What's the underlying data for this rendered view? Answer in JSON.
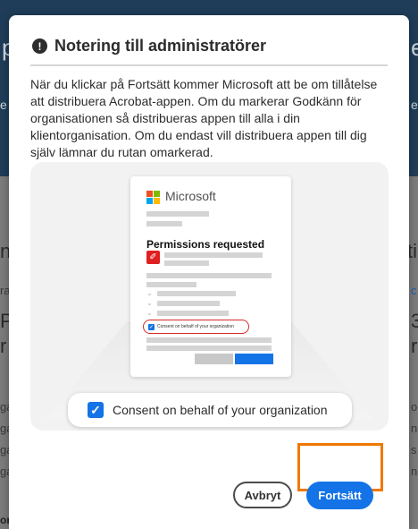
{
  "background": {
    "fragments_top": [
      "p",
      "e"
    ],
    "fragments_bottom": [
      "ne",
      "ra",
      "Po",
      "r",
      "ga",
      "ga",
      "ga",
      "ga"
    ],
    "fragments_right": [
      "e",
      "e",
      "ti",
      "c",
      "3",
      "r",
      "o",
      "n",
      "s",
      "n"
    ],
    "config_label": "onfigurera"
  },
  "dialog": {
    "title": "Notering till administratörer",
    "body": "När du klickar på Fortsätt kommer Microsoft att be om tillåtelse att distribuera Acrobat-appen. Om du markerar Godkänn för organisationen så distribueras appen till alla i din klientorganisation. Om du endast vill distribuera appen till dig själv lämnar du rutan omarkerad.",
    "icons": {
      "alert": "alert-circle-icon",
      "checkbox": "checkbox-checked-icon",
      "pdf": "pdf-icon",
      "brand": "microsoft-logo"
    },
    "illustration": {
      "brand": "Microsoft",
      "heading": "Permissions requested",
      "mini_consent": "Consent on behalf of your organization",
      "consent_label": "Consent on behalf of your organization",
      "consent_checked": true
    },
    "buttons": {
      "cancel": "Avbryt",
      "continue": "Fortsätt"
    },
    "colors": {
      "accent": "#1473e6",
      "highlight": "#f07800",
      "warning": "#d62a2a"
    }
  }
}
